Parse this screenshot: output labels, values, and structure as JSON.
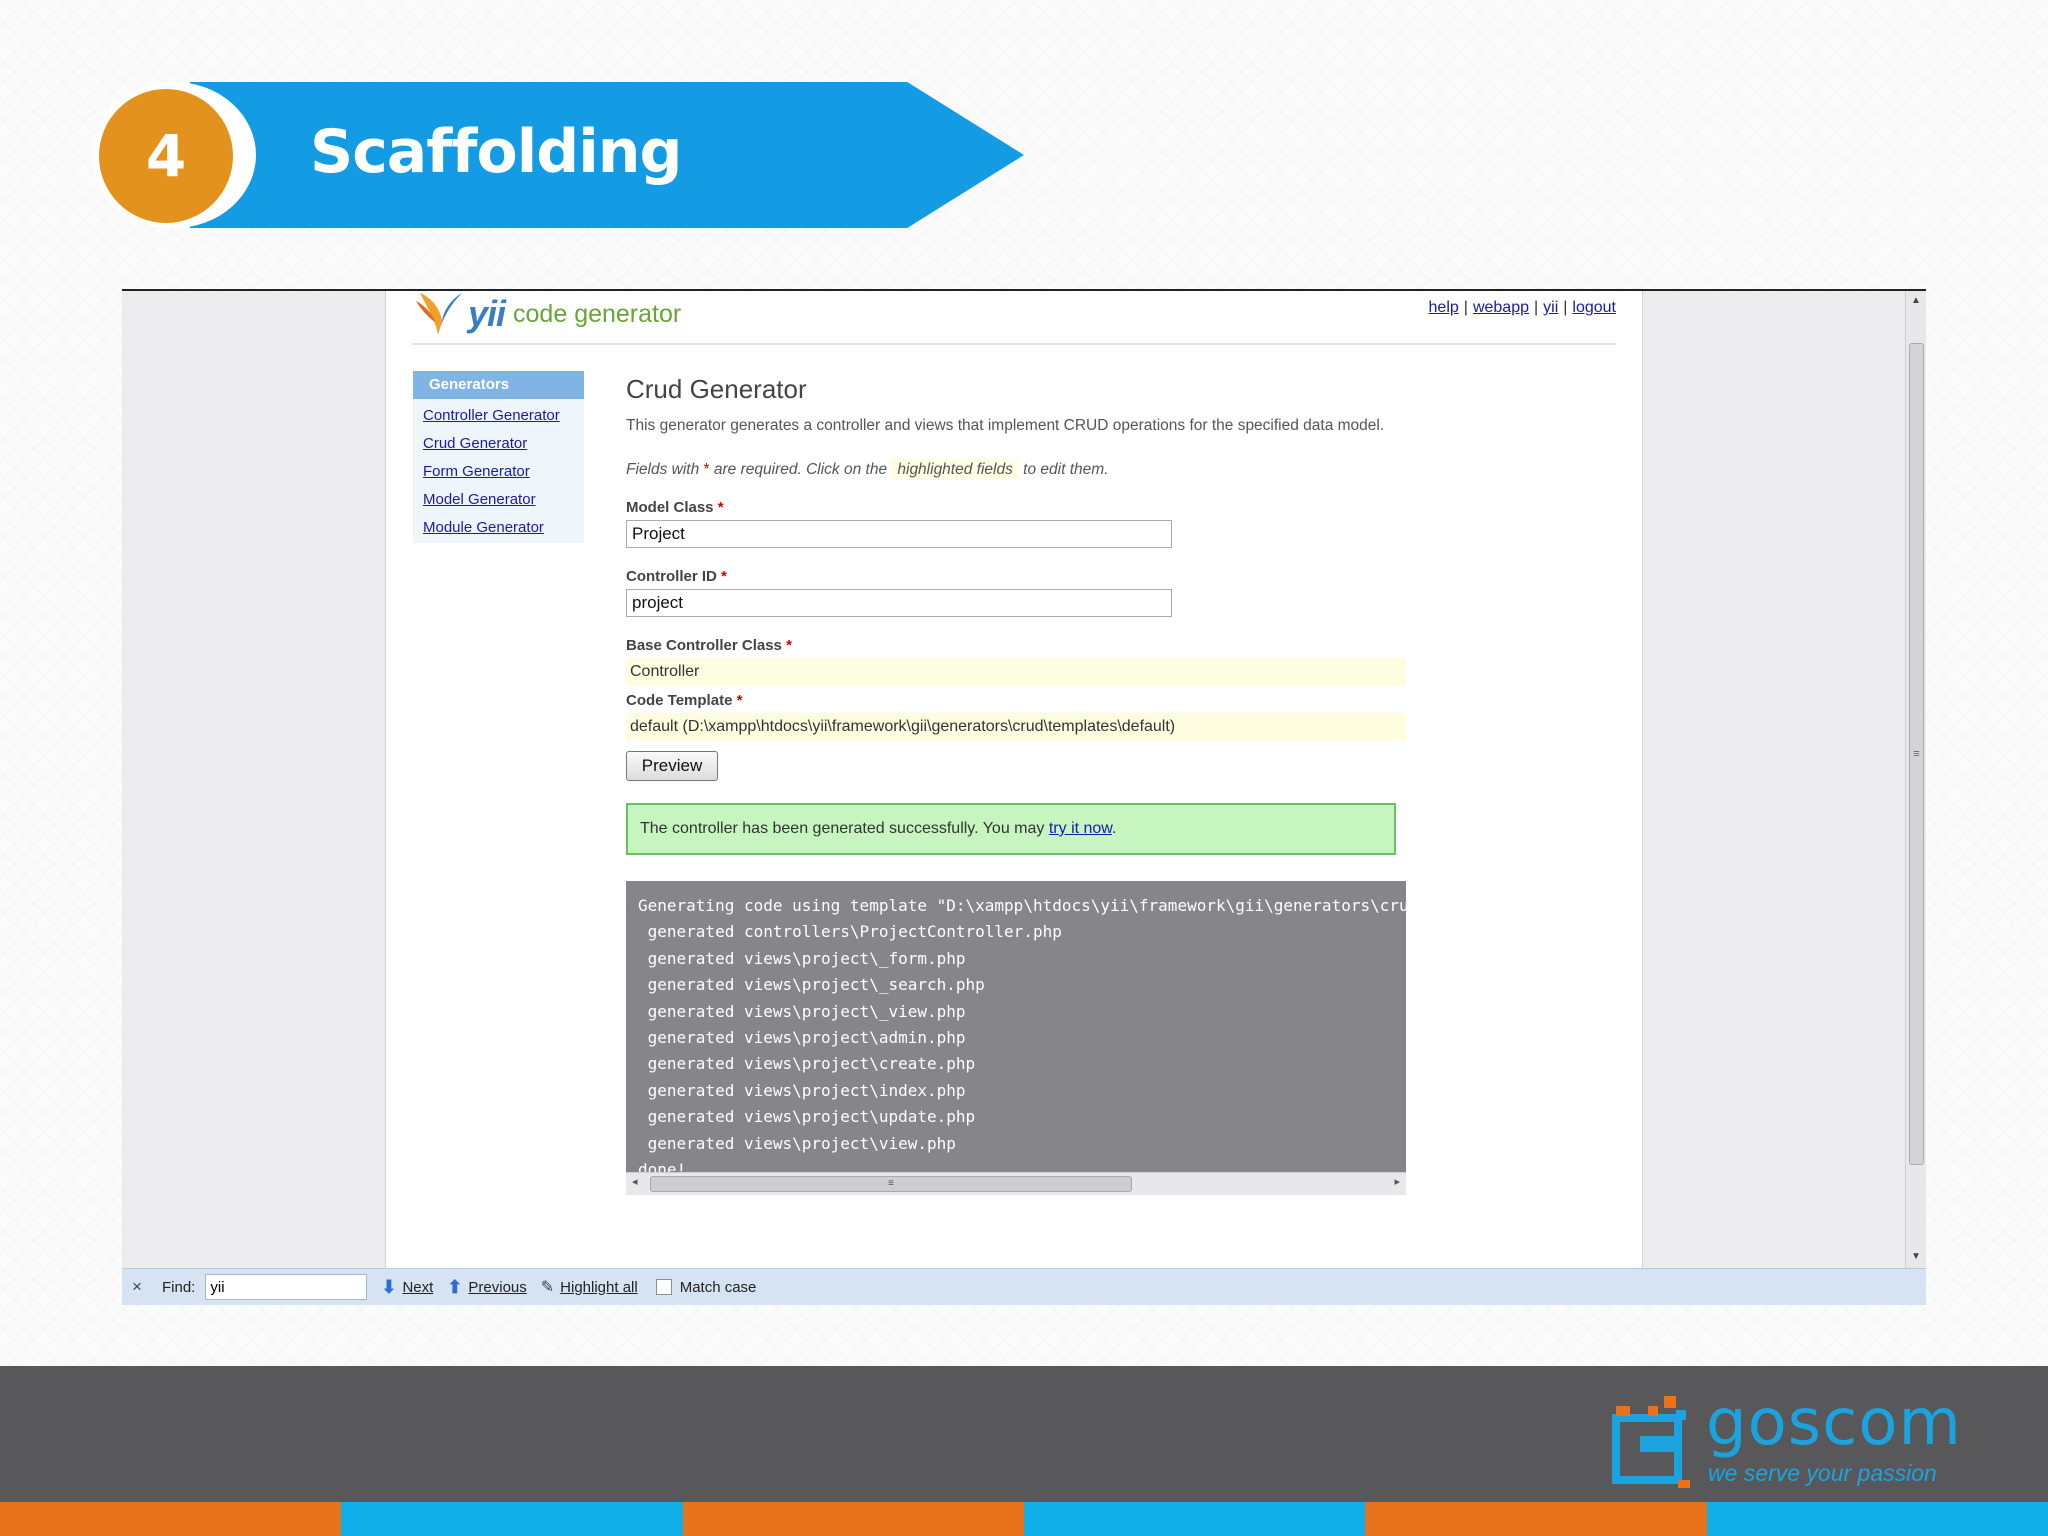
{
  "slide": {
    "number": "4",
    "title": "Scaffolding"
  },
  "app": {
    "logo_yii": "yii",
    "logo_subtitle": "code generator",
    "top_links": [
      "help",
      "webapp",
      "yii",
      "logout"
    ],
    "sidebar": {
      "heading": "Generators",
      "items": [
        "Controller Generator",
        "Crud Generator",
        "Form Generator",
        "Model Generator",
        "Module Generator"
      ]
    },
    "main": {
      "title": "Crud Generator",
      "description": "This generator generates a controller and views that implement CRUD operations for the specified data model.",
      "note_prefix": "Fields with",
      "note_star": "*",
      "note_middle": "are required. Click on the",
      "note_highlight": "highlighted fields",
      "note_suffix": "to edit them.",
      "fields": {
        "model_class_label": "Model Class",
        "model_class_value": "Project",
        "controller_id_label": "Controller ID",
        "controller_id_value": "project",
        "base_controller_label": "Base Controller Class",
        "base_controller_value": "Controller",
        "code_template_label": "Code Template",
        "code_template_value": "default (D:\\xampp\\htdocs\\yii\\framework\\gii\\generators\\crud\\templates\\default)",
        "required_mark": "*"
      },
      "preview_label": "Preview",
      "success_text": "The controller has been generated successfully. You may",
      "success_link": "try it now",
      "success_end": ".",
      "log": "Generating code using template \"D:\\xampp\\htdocs\\yii\\framework\\gii\\generators\\crud\\templates\\default\"...\n generated controllers\\ProjectController.php\n generated views\\project\\_form.php\n generated views\\project\\_search.php\n generated views\\project\\_view.php\n generated views\\project\\admin.php\n generated views\\project\\create.php\n generated views\\project\\index.php\n generated views\\project\\update.php\n generated views\\project\\view.php\ndone!"
    },
    "findbar": {
      "close": "×",
      "label": "Find:",
      "query": "yii",
      "next": "Next",
      "previous": "Previous",
      "highlight_all": "Highlight all",
      "match_case": "Match case"
    }
  },
  "footer": {
    "brand": "goscom",
    "tagline": "we serve your passion",
    "bar_colors": [
      "#e8731c",
      "#10aee8",
      "#e8731c",
      "#10aee8",
      "#e8731c",
      "#10aee8"
    ]
  },
  "colors": {
    "banner_blue": "#139be3",
    "badge_orange": "#e4921e",
    "success_green": "#c6f5c0",
    "link_blue": "#1a1aa8"
  }
}
